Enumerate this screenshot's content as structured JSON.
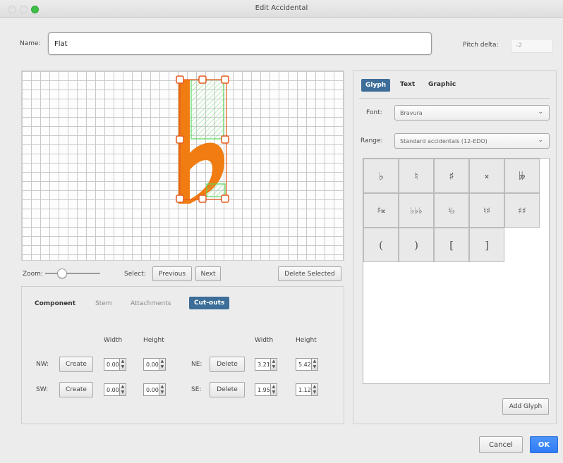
{
  "window": {
    "title": "Edit Accidental",
    "traffic_lights": [
      "#e4e4e4",
      "#e4e4e4",
      "#3fbf47"
    ]
  },
  "name": {
    "label": "Name:",
    "value": "Flat"
  },
  "pitch_delta": {
    "label": "Pitch delta:",
    "value": "-2"
  },
  "canvas": {
    "glyph_color": "#f07c12",
    "cutout_color": "#5cd65c",
    "handle_color": "#e55a1c"
  },
  "toolbar": {
    "zoom_label": "Zoom:",
    "zoom_level": 0.25,
    "select_label": "Select:",
    "previous_label": "Previous",
    "next_label": "Next",
    "delete_selected_label": "Delete Selected"
  },
  "component_tabs": {
    "component": "Component",
    "stem": "Stem",
    "attachments": "Attachments",
    "cutouts": "Cut-outs"
  },
  "cutouts": {
    "width_header": "Width",
    "height_header": "Height",
    "nw": {
      "label": "NW:",
      "button": "Create",
      "width": "0.00",
      "height": "0.00"
    },
    "sw": {
      "label": "SW:",
      "button": "Create",
      "width": "0.00",
      "height": "0.00"
    },
    "ne": {
      "label": "NE:",
      "button": "Delete",
      "width": "3.21",
      "height": "5.42"
    },
    "se": {
      "label": "SE:",
      "button": "Delete",
      "width": "1.95",
      "height": "1.12"
    }
  },
  "right_tabs": {
    "glyph": "Glyph",
    "text": "Text",
    "graphic": "Graphic"
  },
  "font": {
    "label": "Font:",
    "value": "Bravura"
  },
  "range": {
    "label": "Range:",
    "value": "Standard accidentals (12-EDO)"
  },
  "glyphs": [
    "♭",
    "♮",
    "♯",
    "𝄪",
    "𝄫",
    "♯𝄪",
    "♭♭♭",
    "♮♭",
    "♮♯",
    "♯♯",
    "(",
    ")",
    "[",
    "]"
  ],
  "buttons": {
    "add_glyph": "Add Glyph",
    "cancel": "Cancel",
    "ok": "OK"
  },
  "colors": {
    "accent": "#3d6e99",
    "ok_button": "#2f7cf6"
  }
}
